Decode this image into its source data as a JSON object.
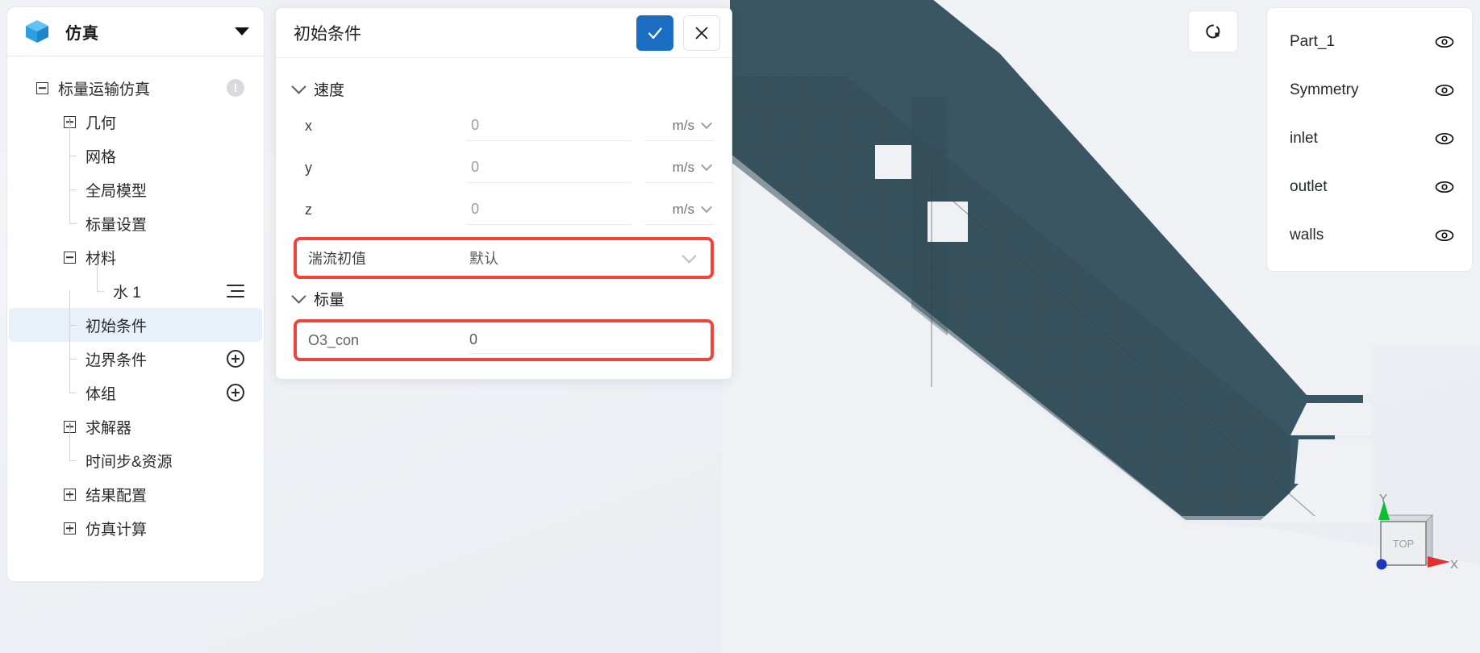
{
  "app": {
    "title": "仿真",
    "logo_icon": "blue-cube-icon",
    "caret_icon": "caret-down-icon"
  },
  "sidebar": {
    "tree": [
      {
        "label": "标量运输仿真",
        "depth": 0,
        "toggle": "minus",
        "icon": "warning-circle-icon",
        "selected": false
      },
      {
        "label": "几何",
        "depth": 1,
        "toggle": "plus",
        "icon": "",
        "selected": false
      },
      {
        "label": "网格",
        "depth": 2,
        "toggle": "elbow",
        "icon": "",
        "selected": false
      },
      {
        "label": "全局模型",
        "depth": 2,
        "toggle": "elbow",
        "icon": "",
        "selected": false
      },
      {
        "label": "标量设置",
        "depth": 2,
        "toggle": "elbow",
        "icon": "",
        "selected": false
      },
      {
        "label": "材料",
        "depth": 1,
        "toggle": "minus",
        "icon": "",
        "selected": false
      },
      {
        "label": "水 1",
        "depth": 3,
        "toggle": "elbow",
        "icon": "list-lines-icon",
        "selected": false
      },
      {
        "label": "初始条件",
        "depth": 2,
        "toggle": "elbow",
        "icon": "",
        "selected": true
      },
      {
        "label": "边界条件",
        "depth": 2,
        "toggle": "elbow",
        "icon": "plus-circle-icon",
        "selected": false
      },
      {
        "label": "体组",
        "depth": 2,
        "toggle": "elbow",
        "icon": "plus-circle-icon",
        "selected": false
      },
      {
        "label": "求解器",
        "depth": 1,
        "toggle": "plus",
        "icon": "",
        "selected": false
      },
      {
        "label": "时间步&资源",
        "depth": 2,
        "toggle": "elbow",
        "icon": "",
        "selected": false
      },
      {
        "label": "结果配置",
        "depth": 1,
        "toggle": "plus",
        "icon": "",
        "selected": false
      },
      {
        "label": "仿真计算",
        "depth": 1,
        "toggle": "plus",
        "icon": "",
        "selected": false
      }
    ]
  },
  "dialog": {
    "title": "初始条件",
    "confirm_icon": "check-icon",
    "cancel_icon": "close-icon",
    "sections": {
      "velocity": {
        "label": "速度",
        "chevron_icon": "chevron-down-icon",
        "rows": [
          {
            "label": "x",
            "value": "0",
            "unit": "m/s",
            "unit_chevron": "chevron-down-icon"
          },
          {
            "label": "y",
            "value": "0",
            "unit": "m/s",
            "unit_chevron": "chevron-down-icon"
          },
          {
            "label": "z",
            "value": "0",
            "unit": "m/s",
            "unit_chevron": "chevron-down-icon"
          }
        ]
      },
      "turbulence": {
        "label": "湍流初值",
        "value": "默认",
        "chevron_icon": "chevron-down-icon",
        "highlighted": true
      },
      "scalar": {
        "label": "标量",
        "chevron_icon": "chevron-down-icon",
        "rows": [
          {
            "label": "O3_con",
            "value": "0",
            "highlighted": true
          }
        ]
      }
    }
  },
  "parts_panel": {
    "items": [
      {
        "label": "Part_1",
        "visibility_icon": "eye-icon"
      },
      {
        "label": "Symmetry",
        "visibility_icon": "eye-icon"
      },
      {
        "label": "inlet",
        "visibility_icon": "eye-icon"
      },
      {
        "label": "outlet",
        "visibility_icon": "eye-icon"
      },
      {
        "label": "walls",
        "visibility_icon": "eye-icon"
      }
    ]
  },
  "viewport": {
    "reset_icon": "reset-view-icon",
    "axis_widget": {
      "face_label": "TOP",
      "x_label": "X",
      "y_label": "Y"
    },
    "geometry_color": "#3b5663",
    "background_color": "#eff1f5"
  },
  "colors": {
    "accent_blue": "#1b6ec2",
    "highlight_red": "#f04438",
    "selected_row": "#e8f1fa",
    "axis_x": "#e03131",
    "axis_y": "#0bbf32",
    "axis_z": "#1b39b8"
  }
}
